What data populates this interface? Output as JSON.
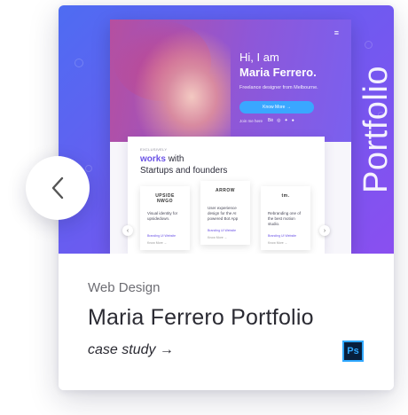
{
  "card": {
    "vertical_label": "Portfolio",
    "category": "Web Design",
    "title": "Maria Ferrero Portfolio",
    "link_label": "case study →",
    "tool_badge": "Ps",
    "tool_icon": "photoshop-icon",
    "colors": {
      "gradient_start": "#4e6cf2",
      "gradient_end": "#8a4ff0",
      "badge_bg": "#071f3d",
      "badge_fg": "#30a8ff"
    }
  },
  "preview": {
    "menu_icon": "≡",
    "greeting": "Hi, I am",
    "name": "Maria Ferrero.",
    "role": "Freelance designer from Melbourne.",
    "cta": "Know More →",
    "join": "Join me here",
    "social": [
      "Bė",
      "◎",
      "✦",
      "●"
    ],
    "kicker": "EXCLUSIVELY",
    "headline_em": "works",
    "headline_rest": "with",
    "headline_line2": "Startups and founders",
    "cards": [
      {
        "logo": "UPSIDE\nNWGO",
        "text": "Visual identity for upsidedown.",
        "tag": "Branding UI Website",
        "more": "Know More →"
      },
      {
        "logo": "ARROW",
        "text": "User experience design for the AI powered Bot App",
        "tag": "Branding UI Website",
        "more": "Know More →"
      },
      {
        "logo": "tm.",
        "text": "Rebranding one of the best motion studio.",
        "tag": "Branding UI Website",
        "more": "Know More →"
      }
    ]
  },
  "nav": {
    "prev_icon": "chevron-left-icon"
  }
}
